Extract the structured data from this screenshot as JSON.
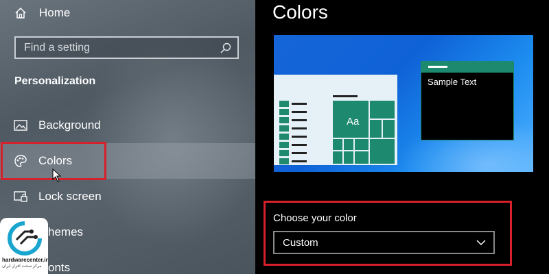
{
  "sidebar": {
    "home_label": "Home",
    "search_placeholder": "Find a setting",
    "section_title": "Personalization",
    "items": [
      {
        "label": "Background",
        "icon": "image-icon"
      },
      {
        "label": "Colors",
        "icon": "palette-icon",
        "selected": true
      },
      {
        "label": "Lock screen",
        "icon": "lock-screen-icon"
      },
      {
        "label": "Themes",
        "icon": "themes-icon",
        "visible_text": "hemes"
      },
      {
        "label": "Fonts",
        "icon": "fonts-icon",
        "visible_text": "onts"
      }
    ]
  },
  "watermark": {
    "site": "hardwarecenter.ir",
    "subtitle": "مرکز سخت افزار ایران"
  },
  "main": {
    "title": "Colors",
    "preview": {
      "tile_text": "Aa",
      "sample_text": "Sample Text"
    },
    "choose_color": {
      "label": "Choose your color",
      "value": "Custom"
    }
  },
  "colors": {
    "highlight": "#d6202a",
    "accent": "#1d8a6f",
    "desktop_blue": "#0f62d6"
  }
}
